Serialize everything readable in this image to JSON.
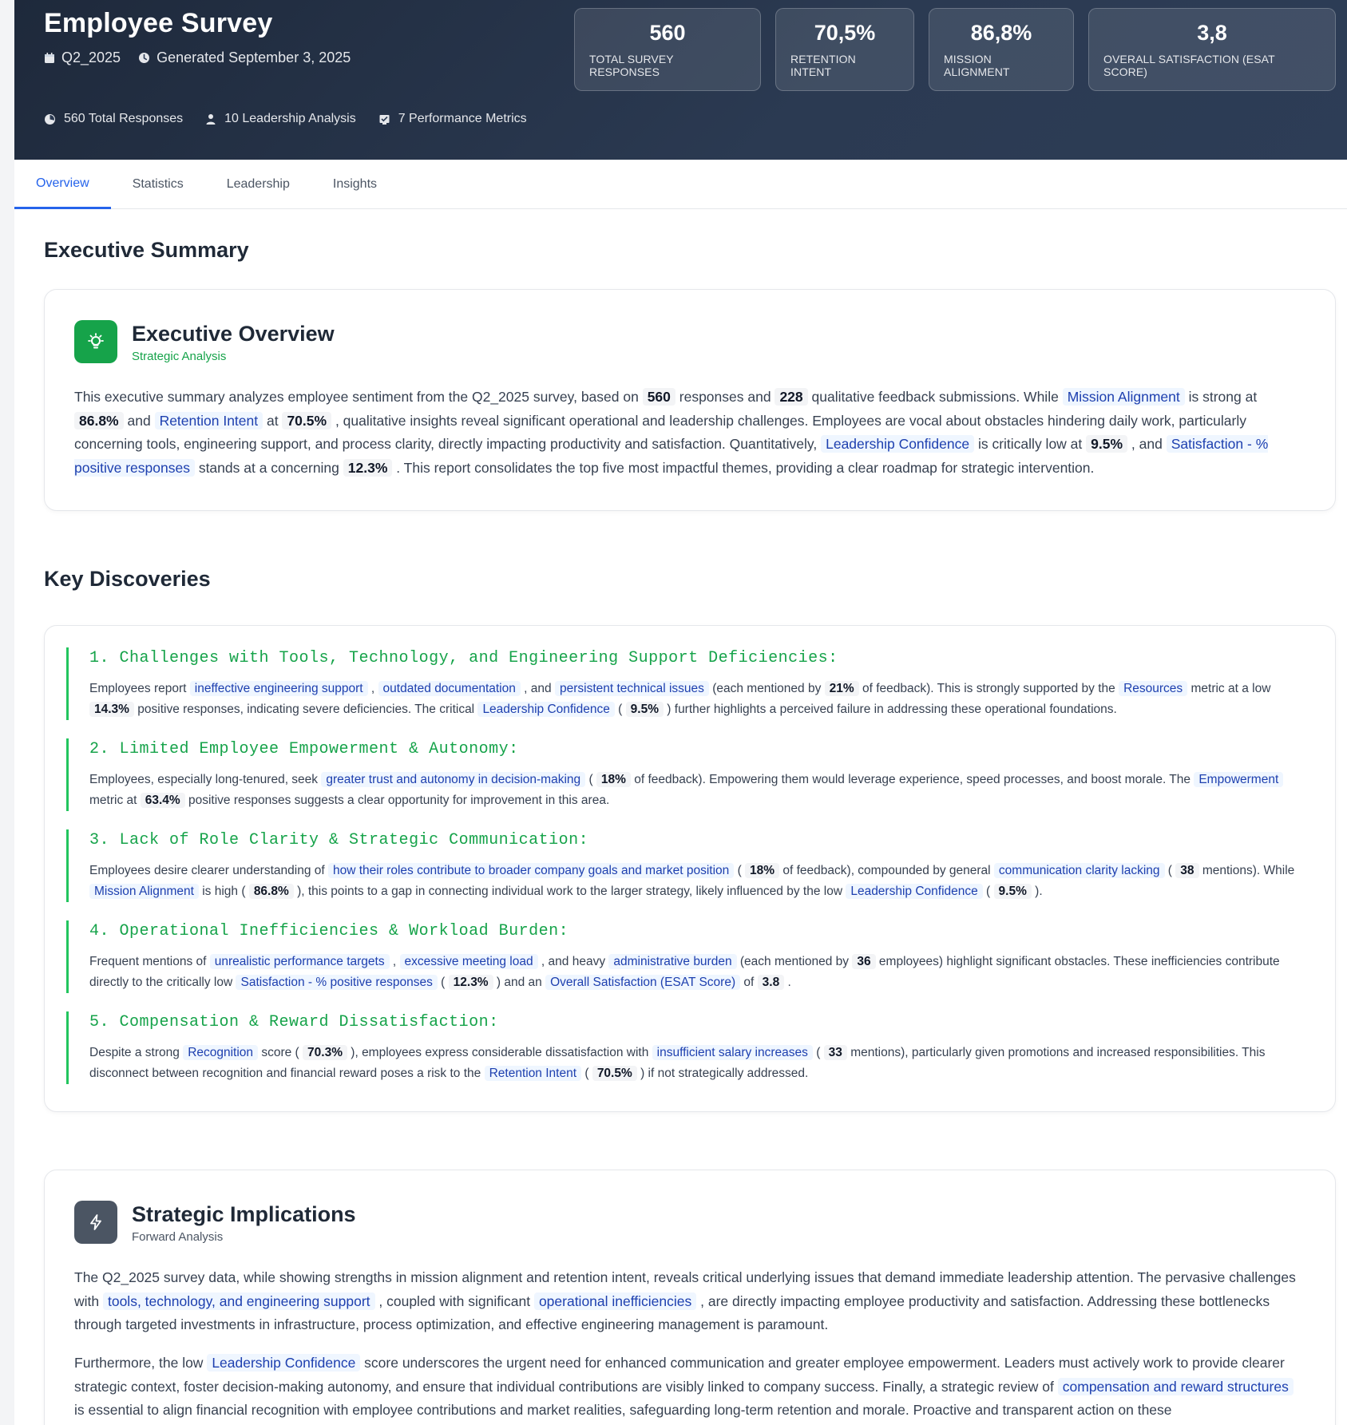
{
  "header": {
    "title": "Employee Survey",
    "period": "Q2_2025",
    "generated": "Generated September 3, 2025",
    "stats": {
      "responses": "560 Total Responses",
      "leadership": "10 Leadership Analysis",
      "metrics": "7 Performance Metrics"
    },
    "kpis": [
      {
        "value": "560",
        "label": "TOTAL SURVEY RESPONSES"
      },
      {
        "value": "70,5%",
        "label": "RETENTION INTENT"
      },
      {
        "value": "86,8%",
        "label": "MISSION ALIGNMENT"
      },
      {
        "value": "3,8",
        "label": "OVERALL SATISFACTION (ESAT SCORE)"
      }
    ]
  },
  "tabs": [
    "Overview",
    "Statistics",
    "Leadership",
    "Insights"
  ],
  "active_tab": "Overview",
  "executive_summary": {
    "section_title": "Executive Summary",
    "card_title": "Executive Overview",
    "card_sub": "Strategic Analysis",
    "p": {
      "t1": "This executive summary analyzes employee sentiment from the Q2_2025 survey, based on ",
      "n1": "560",
      "t2": " responses and ",
      "n2": "228",
      "t3": " qualitative feedback submissions. While ",
      "h1": "Mission Alignment",
      "t4": " is strong at ",
      "n3": "86.8%",
      "t5": " and ",
      "h2": "Retention Intent",
      "t6": " at ",
      "n4": "70.5%",
      "t7": " , qualitative insights reveal significant operational and leadership challenges. Employees are vocal about obstacles hindering daily work, particularly concerning tools, engineering support, and process clarity, directly impacting productivity and satisfaction. Quantitatively, ",
      "h3": "Leadership Confidence",
      "t8": " is critically low at ",
      "n5": "9.5%",
      "t9": " , and ",
      "h4": "Satisfaction - % positive responses",
      "t10": " stands at a concerning ",
      "n6": "12.3%",
      "t11": " . This report consolidates the top five most impactful themes, providing a clear roadmap for strategic intervention."
    }
  },
  "key_discoveries": {
    "section_title": "Key Discoveries",
    "items": [
      {
        "title": "1. Challenges with Tools, Technology, and Engineering Support Deficiencies:",
        "parts": [
          [
            "t",
            "Employees report "
          ],
          [
            "h",
            "ineffective engineering support"
          ],
          [
            "t",
            " , "
          ],
          [
            "h",
            "outdated documentation"
          ],
          [
            "t",
            " , and "
          ],
          [
            "h",
            "persistent technical issues"
          ],
          [
            "t",
            " (each mentioned by "
          ],
          [
            "n",
            "21%"
          ],
          [
            "t",
            " of feedback). This is strongly supported by the "
          ],
          [
            "h",
            "Resources"
          ],
          [
            "t",
            " metric at a low "
          ],
          [
            "n",
            "14.3%"
          ],
          [
            "t",
            " positive responses, indicating severe deficiencies. The critical "
          ],
          [
            "h",
            "Leadership Confidence"
          ],
          [
            "t",
            " ( "
          ],
          [
            "n",
            "9.5%"
          ],
          [
            "t",
            " ) further highlights a perceived failure in addressing these operational foundations."
          ]
        ]
      },
      {
        "title": "2. Limited Employee Empowerment & Autonomy:",
        "parts": [
          [
            "t",
            "Employees, especially long-tenured, seek "
          ],
          [
            "h",
            "greater trust and autonomy in decision-making"
          ],
          [
            "t",
            " ( "
          ],
          [
            "n",
            "18%"
          ],
          [
            "t",
            " of feedback). Empowering them would leverage experience, speed processes, and boost morale. The "
          ],
          [
            "h",
            "Empowerment"
          ],
          [
            "t",
            " metric at "
          ],
          [
            "n",
            "63.4%"
          ],
          [
            "t",
            " positive responses suggests a clear opportunity for improvement in this area."
          ]
        ]
      },
      {
        "title": "3. Lack of Role Clarity & Strategic Communication:",
        "parts": [
          [
            "t",
            "Employees desire clearer understanding of "
          ],
          [
            "h",
            "how their roles contribute to broader company goals and market position"
          ],
          [
            "t",
            " ( "
          ],
          [
            "n",
            "18%"
          ],
          [
            "t",
            " of feedback), compounded by general "
          ],
          [
            "h",
            "communication clarity lacking"
          ],
          [
            "t",
            " ( "
          ],
          [
            "n",
            "38"
          ],
          [
            "t",
            " mentions). While "
          ],
          [
            "h",
            "Mission Alignment"
          ],
          [
            "t",
            " is high ( "
          ],
          [
            "n",
            "86.8%"
          ],
          [
            "t",
            " ), this points to a gap in connecting individual work to the larger strategy, likely influenced by the low "
          ],
          [
            "h",
            "Leadership Confidence"
          ],
          [
            "t",
            " ( "
          ],
          [
            "n",
            "9.5%"
          ],
          [
            "t",
            " )."
          ]
        ]
      },
      {
        "title": "4. Operational Inefficiencies & Workload Burden:",
        "parts": [
          [
            "t",
            "Frequent mentions of "
          ],
          [
            "h",
            "unrealistic performance targets"
          ],
          [
            "t",
            " , "
          ],
          [
            "h",
            "excessive meeting load"
          ],
          [
            "t",
            " , and heavy "
          ],
          [
            "h",
            "administrative burden"
          ],
          [
            "t",
            " (each mentioned by "
          ],
          [
            "n",
            "36"
          ],
          [
            "t",
            " employees) highlight significant obstacles. These inefficiencies contribute directly to the critically low "
          ],
          [
            "h",
            "Satisfaction - % positive responses"
          ],
          [
            "t",
            " ( "
          ],
          [
            "n",
            "12.3%"
          ],
          [
            "t",
            " ) and an "
          ],
          [
            "h",
            "Overall Satisfaction (ESAT Score)"
          ],
          [
            "t",
            " of "
          ],
          [
            "n",
            "3.8"
          ],
          [
            "t",
            " ."
          ]
        ]
      },
      {
        "title": "5. Compensation & Reward Dissatisfaction:",
        "parts": [
          [
            "t",
            "Despite a strong "
          ],
          [
            "h",
            "Recognition"
          ],
          [
            "t",
            " score ( "
          ],
          [
            "n",
            "70.3%"
          ],
          [
            "t",
            " ), employees express considerable dissatisfaction with "
          ],
          [
            "h",
            "insufficient salary increases"
          ],
          [
            "t",
            " ( "
          ],
          [
            "n",
            "33"
          ],
          [
            "t",
            " mentions), particularly given promotions and increased responsibilities. This disconnect between recognition and financial reward poses a risk to the "
          ],
          [
            "h",
            "Retention Intent"
          ],
          [
            "t",
            " ( "
          ],
          [
            "n",
            "70.5%"
          ],
          [
            "t",
            " ) if not strategically addressed."
          ]
        ]
      }
    ]
  },
  "strategic": {
    "card_title": "Strategic Implications",
    "card_sub": "Forward Analysis",
    "p1": [
      [
        "t",
        "The Q2_2025 survey data, while showing strengths in mission alignment and retention intent, reveals critical underlying issues that demand immediate leadership attention. The pervasive challenges with "
      ],
      [
        "h",
        "tools, technology, and engineering support"
      ],
      [
        "t",
        " , coupled with significant "
      ],
      [
        "h",
        "operational inefficiencies"
      ],
      [
        "t",
        " , are directly impacting employee productivity and satisfaction. Addressing these bottlenecks through targeted investments in infrastructure, process optimization, and effective engineering management is paramount."
      ]
    ],
    "p2": [
      [
        "t",
        "Furthermore, the low "
      ],
      [
        "h",
        "Leadership Confidence"
      ],
      [
        "t",
        " score underscores the urgent need for enhanced communication and greater employee empowerment. Leaders must actively work to provide clearer strategic context, foster decision-making autonomy, and ensure that individual contributions are visibly linked to company success. Finally, a strategic review of "
      ],
      [
        "h",
        "compensation and reward structures"
      ],
      [
        "t",
        " is essential to align financial recognition with employee contributions and market realities, safeguarding long-term retention and morale. Proactive and transparent action on these"
      ]
    ]
  },
  "colors": {
    "header_bg": "#1e293b",
    "accent_blue": "#2563eb",
    "accent_green": "#16a34a",
    "highlight_bg": "#eff6ff"
  },
  "icons": {
    "period": "calendar-icon",
    "generated": "clock-icon",
    "responses": "chart-circle-icon",
    "leadership": "person-icon",
    "metrics": "checklist-icon",
    "executive": "lightbulb-icon",
    "strategic": "lightning-icon"
  }
}
